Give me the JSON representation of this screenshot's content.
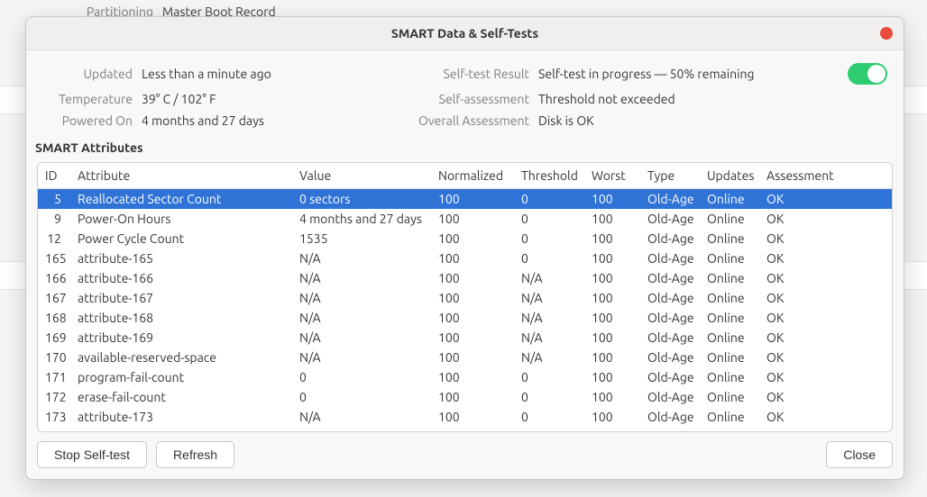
{
  "backdrop": {
    "partitioning_label": "Partitioning",
    "partitioning_value": "Master Boot Record"
  },
  "dialog": {
    "title": "SMART Data & Self-Tests",
    "toggle_on": true
  },
  "info": {
    "updated_label": "Updated",
    "updated": "Less than a minute ago",
    "temperature_label": "Temperature",
    "temperature": "39° C / 102° F",
    "powered_on_label": "Powered On",
    "powered_on": "4 months and 27 days",
    "self_test_result_label": "Self-test Result",
    "self_test_result": "Self-test in progress — 50% remaining",
    "self_assessment_label": "Self-assessment",
    "self_assessment": "Threshold not exceeded",
    "overall_assessment_label": "Overall Assessment",
    "overall_assessment": "Disk is OK"
  },
  "attributes_header": "SMART Attributes",
  "columns": {
    "id": "ID",
    "attribute": "Attribute",
    "value": "Value",
    "normalized": "Normalized",
    "threshold": "Threshold",
    "worst": "Worst",
    "type": "Type",
    "updates": "Updates",
    "assessment": "Assessment"
  },
  "rows": [
    {
      "id": "5",
      "attribute": "Reallocated Sector Count",
      "value": "0 sectors",
      "normalized": "100",
      "threshold": "0",
      "worst": "100",
      "type": "Old-Age",
      "updates": "Online",
      "assessment": "OK",
      "selected": true
    },
    {
      "id": "9",
      "attribute": "Power-On Hours",
      "value": "4 months and 27 days",
      "normalized": "100",
      "threshold": "0",
      "worst": "100",
      "type": "Old-Age",
      "updates": "Online",
      "assessment": "OK"
    },
    {
      "id": "12",
      "attribute": "Power Cycle Count",
      "value": "1535",
      "normalized": "100",
      "threshold": "0",
      "worst": "100",
      "type": "Old-Age",
      "updates": "Online",
      "assessment": "OK"
    },
    {
      "id": "165",
      "attribute": "attribute-165",
      "value": "N/A",
      "normalized": "100",
      "threshold": "0",
      "worst": "100",
      "type": "Old-Age",
      "updates": "Online",
      "assessment": "OK"
    },
    {
      "id": "166",
      "attribute": "attribute-166",
      "value": "N/A",
      "normalized": "100",
      "threshold": "N/A",
      "worst": "100",
      "type": "Old-Age",
      "updates": "Online",
      "assessment": "OK"
    },
    {
      "id": "167",
      "attribute": "attribute-167",
      "value": "N/A",
      "normalized": "100",
      "threshold": "N/A",
      "worst": "100",
      "type": "Old-Age",
      "updates": "Online",
      "assessment": "OK"
    },
    {
      "id": "168",
      "attribute": "attribute-168",
      "value": "N/A",
      "normalized": "100",
      "threshold": "N/A",
      "worst": "100",
      "type": "Old-Age",
      "updates": "Online",
      "assessment": "OK"
    },
    {
      "id": "169",
      "attribute": "attribute-169",
      "value": "N/A",
      "normalized": "100",
      "threshold": "N/A",
      "worst": "100",
      "type": "Old-Age",
      "updates": "Online",
      "assessment": "OK"
    },
    {
      "id": "170",
      "attribute": "available-reserved-space",
      "value": "N/A",
      "normalized": "100",
      "threshold": "N/A",
      "worst": "100",
      "type": "Old-Age",
      "updates": "Online",
      "assessment": "OK"
    },
    {
      "id": "171",
      "attribute": "program-fail-count",
      "value": "0",
      "normalized": "100",
      "threshold": "0",
      "worst": "100",
      "type": "Old-Age",
      "updates": "Online",
      "assessment": "OK"
    },
    {
      "id": "172",
      "attribute": "erase-fail-count",
      "value": "0",
      "normalized": "100",
      "threshold": "0",
      "worst": "100",
      "type": "Old-Age",
      "updates": "Online",
      "assessment": "OK"
    },
    {
      "id": "173",
      "attribute": "attribute-173",
      "value": "N/A",
      "normalized": "100",
      "threshold": "0",
      "worst": "100",
      "type": "Old-Age",
      "updates": "Online",
      "assessment": "OK"
    }
  ],
  "buttons": {
    "stop": "Stop Self-test",
    "refresh": "Refresh",
    "close": "Close"
  }
}
